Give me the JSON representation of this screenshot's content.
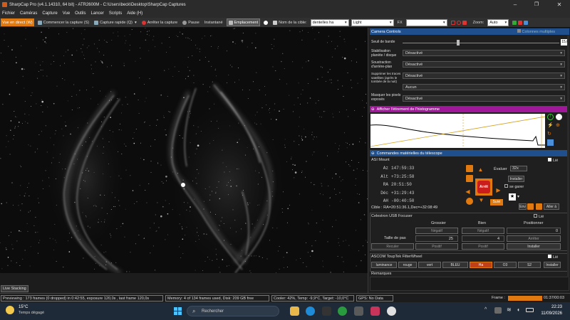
{
  "window": {
    "title": "SharpCap Pro (v4.1.14310, 64 bit) - ATR2600M - C:\\Users\\beck\\Desktop\\SharpCap Captures"
  },
  "menu": [
    "Fichier",
    "Caméras",
    "Capture",
    "Vue",
    "Outils",
    "Lancer",
    "Scripts",
    "Aide (H)"
  ],
  "toolbar": {
    "live_view": "Vue en direct (W)",
    "start_capture": "Commencer la capture (S)",
    "quick_capture": "Capture rapide (Q)",
    "stop_capture": "Arrêter la capture",
    "pause": "Pause",
    "snapshot": "Instantané",
    "framing": "Emplacement",
    "target_label": "Nom de la cible:",
    "target_value": "dentelles ha",
    "light_value": "Light",
    "fx_label": "FX",
    "zoom_label": "Zoom:",
    "zoom_value": "Auto"
  },
  "camera_controls": {
    "header": "Camera Controls",
    "multi_columns": "Colonnes multiples",
    "bandwidth_label": "Seuil de bande",
    "bandwidth_value": "15,0",
    "rows": [
      {
        "label": "Stabilisation planète / disque",
        "value": "Désactivé"
      },
      {
        "label": "Soustraction d'arrière-plan",
        "value": "Désactivé"
      },
      {
        "label": "Supprimer les traces satellites (après le tombée de la nuit)",
        "value": "Désactivé"
      },
      {
        "label": "Masquer les pixels exposés",
        "value": "Aucun"
      },
      {
        "label": "Masquer les pixels exposés",
        "value": "Désactivé"
      }
    ]
  },
  "histogram": {
    "header": "Afficher l'étirement de l'histogramme"
  },
  "telescope": {
    "header": "Commandes matérielles du télescope",
    "mount_name": "ASI Mount",
    "linked": "Lié",
    "az_label": "Az",
    "az_value": "147:59:33",
    "alt_label": "Alt",
    "alt_value": "+73:25:58",
    "ra_label": "RA",
    "ra_value": "20:51:50",
    "dec_label": "Déc",
    "dec_value": "+31:29:43",
    "ah_label": "AH",
    "ah_value": "-00:40:50",
    "rate_label": "Évaluer",
    "rate_value": "32x",
    "install_label": "Installer",
    "park_label": "se garer",
    "stop_label": "Arrêt",
    "follow_label": "Suivi",
    "target_text": "Cible : RA=20:51:36.1,Dec=+32:08:49",
    "env_label": "Env",
    "goto_label": "Aller à"
  },
  "focuser": {
    "header": "Celestron USB Focuser",
    "linked": "Lié",
    "col_coarse": "Grossier",
    "col_fine": "Bien",
    "col_position": "Positionner",
    "negative": "Négatif",
    "negative2": "Négatif",
    "position_value": "0",
    "step_label": "Taille de pas",
    "coarse_step": "25",
    "fine_step": "4",
    "stop": "Arrêter",
    "back": "Reculer",
    "positive": "Positif",
    "positive2": "Positif",
    "install": "Installer"
  },
  "filterwheel": {
    "header": "ASCOM ToupTek FilterWheel",
    "linked": "Lié",
    "filters": [
      "luminance",
      "rouge",
      "vert",
      "BLEU",
      "Ha",
      "O3",
      "S2"
    ],
    "selected": "Ha",
    "install": "Installer",
    "remarks": "Remarques"
  },
  "live_stacking": "Live Stacking",
  "status": {
    "preview": "Previewing : 173 frames (0 dropped) in 0:42:55, exposure 120,0s , last frame 120,0s",
    "memory": "Memory: 4 of 134 frames used, Disk: 209 GB free",
    "cooler": "Cooler: 42%, Temp: -9,9°C, Target: -10,0°C",
    "gps": "GPS: No Data",
    "frame_label": "Frame :",
    "frame_time": "01:37/00:03"
  },
  "taskbar": {
    "weather_temp": "15°C",
    "weather_desc": "Temps dégagé",
    "search": "Rechercher",
    "time": "22:23",
    "date": "11/09/2026"
  },
  "colors": {
    "accent_orange": "#e07a10",
    "section_blue": "#1f4f8c",
    "histogram_magenta": "#a0189a",
    "filter_selected": "#c0401a"
  }
}
